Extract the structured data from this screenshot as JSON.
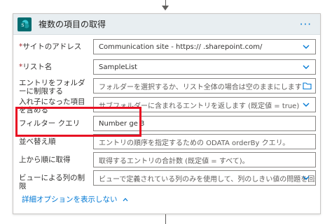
{
  "card": {
    "title": "複数の項目の取得",
    "more_label": "···"
  },
  "fields": [
    {
      "label": "サイトのアドレス",
      "required": true,
      "value": "Communication site - https://              .sharepoint.com/",
      "control": "dropdown"
    },
    {
      "label": "リスト名",
      "required": true,
      "value": "SampleList",
      "control": "dropdown"
    },
    {
      "label": "エントリをフォルダーに制限する",
      "required": false,
      "value": "フォルダーを選択するか、リスト全体の場合は空のままにします",
      "control": "folder",
      "placeholder": true
    },
    {
      "label": "入れ子になった項目を含める",
      "required": false,
      "value": "サブフォルダーに含まれるエントリを返します (既定値 = true)",
      "control": "dropdown",
      "placeholder": true
    },
    {
      "label": "フィルター クエリ",
      "required": false,
      "value": "Number ge 3",
      "control": "text"
    },
    {
      "label": "並べ替え順",
      "required": false,
      "value": "エントリの順序を指定するための ODATA orderBy クエリ。",
      "control": "text",
      "placeholder": true
    },
    {
      "label": "上から順に取得",
      "required": false,
      "value": "取得するエントリの合計数 (既定値 = すべて)。",
      "control": "text",
      "placeholder": true
    },
    {
      "label": "ビューによる列の制限",
      "required": false,
      "value": "ビューで定義されている列のみを使用して、列のしきい値の問題を回避",
      "control": "dropdown",
      "placeholder": true
    }
  ],
  "advanced_options_label": "詳細オプションを表示しない",
  "required_marker": "*",
  "colors": {
    "accent": "#0078d4",
    "highlight": "#e81123",
    "header_bg": "#e8eef1",
    "sharepoint": "#036c70"
  }
}
